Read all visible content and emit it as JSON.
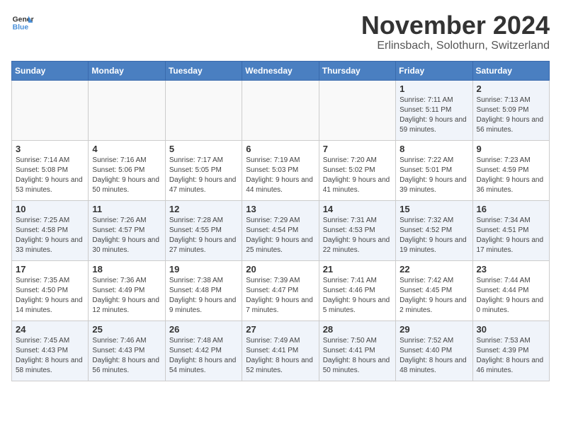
{
  "header": {
    "logo_line1": "General",
    "logo_line2": "Blue",
    "month": "November 2024",
    "location": "Erlinsbach, Solothurn, Switzerland"
  },
  "weekdays": [
    "Sunday",
    "Monday",
    "Tuesday",
    "Wednesday",
    "Thursday",
    "Friday",
    "Saturday"
  ],
  "weeks": [
    [
      {
        "day": "",
        "info": ""
      },
      {
        "day": "",
        "info": ""
      },
      {
        "day": "",
        "info": ""
      },
      {
        "day": "",
        "info": ""
      },
      {
        "day": "",
        "info": ""
      },
      {
        "day": "1",
        "info": "Sunrise: 7:11 AM\nSunset: 5:11 PM\nDaylight: 9 hours and 59 minutes."
      },
      {
        "day": "2",
        "info": "Sunrise: 7:13 AM\nSunset: 5:09 PM\nDaylight: 9 hours and 56 minutes."
      }
    ],
    [
      {
        "day": "3",
        "info": "Sunrise: 7:14 AM\nSunset: 5:08 PM\nDaylight: 9 hours and 53 minutes."
      },
      {
        "day": "4",
        "info": "Sunrise: 7:16 AM\nSunset: 5:06 PM\nDaylight: 9 hours and 50 minutes."
      },
      {
        "day": "5",
        "info": "Sunrise: 7:17 AM\nSunset: 5:05 PM\nDaylight: 9 hours and 47 minutes."
      },
      {
        "day": "6",
        "info": "Sunrise: 7:19 AM\nSunset: 5:03 PM\nDaylight: 9 hours and 44 minutes."
      },
      {
        "day": "7",
        "info": "Sunrise: 7:20 AM\nSunset: 5:02 PM\nDaylight: 9 hours and 41 minutes."
      },
      {
        "day": "8",
        "info": "Sunrise: 7:22 AM\nSunset: 5:01 PM\nDaylight: 9 hours and 39 minutes."
      },
      {
        "day": "9",
        "info": "Sunrise: 7:23 AM\nSunset: 4:59 PM\nDaylight: 9 hours and 36 minutes."
      }
    ],
    [
      {
        "day": "10",
        "info": "Sunrise: 7:25 AM\nSunset: 4:58 PM\nDaylight: 9 hours and 33 minutes."
      },
      {
        "day": "11",
        "info": "Sunrise: 7:26 AM\nSunset: 4:57 PM\nDaylight: 9 hours and 30 minutes."
      },
      {
        "day": "12",
        "info": "Sunrise: 7:28 AM\nSunset: 4:55 PM\nDaylight: 9 hours and 27 minutes."
      },
      {
        "day": "13",
        "info": "Sunrise: 7:29 AM\nSunset: 4:54 PM\nDaylight: 9 hours and 25 minutes."
      },
      {
        "day": "14",
        "info": "Sunrise: 7:31 AM\nSunset: 4:53 PM\nDaylight: 9 hours and 22 minutes."
      },
      {
        "day": "15",
        "info": "Sunrise: 7:32 AM\nSunset: 4:52 PM\nDaylight: 9 hours and 19 minutes."
      },
      {
        "day": "16",
        "info": "Sunrise: 7:34 AM\nSunset: 4:51 PM\nDaylight: 9 hours and 17 minutes."
      }
    ],
    [
      {
        "day": "17",
        "info": "Sunrise: 7:35 AM\nSunset: 4:50 PM\nDaylight: 9 hours and 14 minutes."
      },
      {
        "day": "18",
        "info": "Sunrise: 7:36 AM\nSunset: 4:49 PM\nDaylight: 9 hours and 12 minutes."
      },
      {
        "day": "19",
        "info": "Sunrise: 7:38 AM\nSunset: 4:48 PM\nDaylight: 9 hours and 9 minutes."
      },
      {
        "day": "20",
        "info": "Sunrise: 7:39 AM\nSunset: 4:47 PM\nDaylight: 9 hours and 7 minutes."
      },
      {
        "day": "21",
        "info": "Sunrise: 7:41 AM\nSunset: 4:46 PM\nDaylight: 9 hours and 5 minutes."
      },
      {
        "day": "22",
        "info": "Sunrise: 7:42 AM\nSunset: 4:45 PM\nDaylight: 9 hours and 2 minutes."
      },
      {
        "day": "23",
        "info": "Sunrise: 7:44 AM\nSunset: 4:44 PM\nDaylight: 9 hours and 0 minutes."
      }
    ],
    [
      {
        "day": "24",
        "info": "Sunrise: 7:45 AM\nSunset: 4:43 PM\nDaylight: 8 hours and 58 minutes."
      },
      {
        "day": "25",
        "info": "Sunrise: 7:46 AM\nSunset: 4:43 PM\nDaylight: 8 hours and 56 minutes."
      },
      {
        "day": "26",
        "info": "Sunrise: 7:48 AM\nSunset: 4:42 PM\nDaylight: 8 hours and 54 minutes."
      },
      {
        "day": "27",
        "info": "Sunrise: 7:49 AM\nSunset: 4:41 PM\nDaylight: 8 hours and 52 minutes."
      },
      {
        "day": "28",
        "info": "Sunrise: 7:50 AM\nSunset: 4:41 PM\nDaylight: 8 hours and 50 minutes."
      },
      {
        "day": "29",
        "info": "Sunrise: 7:52 AM\nSunset: 4:40 PM\nDaylight: 8 hours and 48 minutes."
      },
      {
        "day": "30",
        "info": "Sunrise: 7:53 AM\nSunset: 4:39 PM\nDaylight: 8 hours and 46 minutes."
      }
    ]
  ]
}
